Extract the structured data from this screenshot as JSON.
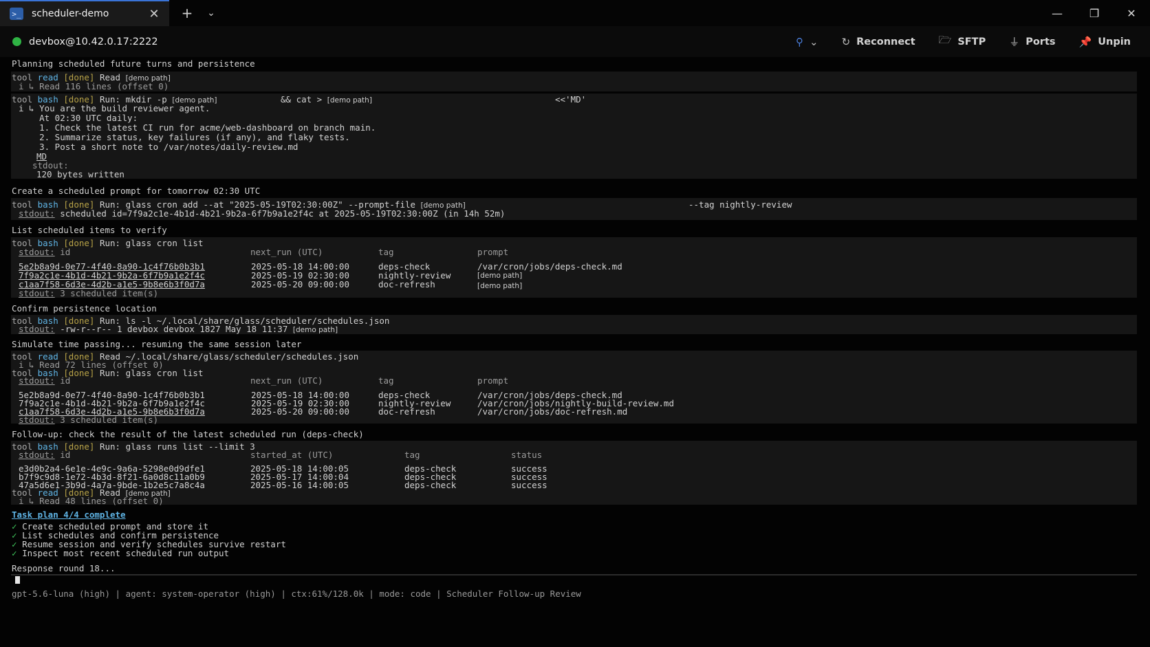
{
  "tab": {
    "title": "scheduler-demo",
    "icon": "terminal-icon"
  },
  "host": {
    "label": "devbox@10.42.0.17:2222",
    "status_color": "#2fb344"
  },
  "actions": {
    "reconnect": "Reconnect",
    "sftp": "SFTP",
    "ports": "Ports",
    "unpin": "Unpin"
  },
  "chip": "[demo path]",
  "s1": {
    "heading": "Planning scheduled future turns and persistence",
    "t1": {
      "tool": "tool",
      "name": "read",
      "status": "[done]",
      "cmd": "Read",
      "sub": "i ↳ Read 116 lines (offset 0)"
    },
    "t2": {
      "tool": "tool",
      "name": "bash",
      "status": "[done]",
      "cmd_a": "Run: mkdir -p",
      "cmd_b": "&& cat >",
      "cmd_c": "<<'MD'",
      "lines": [
        "i ↳ You are the build reviewer agent.",
        "    At 02:30 UTC daily:",
        "    1. Check the latest CI run for acme/web-dashboard on branch main.",
        "    2. Summarize status, key failures (if any), and flaky tests.",
        "    3. Post a short note to /var/notes/daily-review.md"
      ],
      "md": "MD",
      "stdout": "stdout:",
      "written": "120 bytes written"
    }
  },
  "s2": {
    "heading": "Create a scheduled prompt for tomorrow 02:30 UTC",
    "cmd_a": "Run: glass cron add --at \"2025-05-19T02:30:00Z\" --prompt-file",
    "cmd_b": "--tag nightly-review",
    "stdout": "stdout:",
    "out": "scheduled id=7f9a2c1e-4b1d-4b21-9b2a-6f7b9a1e2f4c at 2025-05-19T02:30:00Z (in 14h 52m)"
  },
  "s3": {
    "heading": "List scheduled items to verify",
    "cmd": "Run: glass cron list",
    "headers": [
      "id",
      "next_run (UTC)",
      "tag",
      "prompt"
    ],
    "rows": [
      {
        "id": "5e2b8a9d-0e77-4f40-8a90-1c4f76b0b3b1",
        "next_run": "2025-05-18 14:00:00",
        "tag": "deps-check",
        "prompt": "/var/cron/jobs/deps-check.md"
      },
      {
        "id": "7f9a2c1e-4b1d-4b21-9b2a-6f7b9a1e2f4c",
        "next_run": "2025-05-19 02:30:00",
        "tag": "nightly-review",
        "prompt": "[demo path]"
      },
      {
        "id": "c1aa7f58-6d3e-4d2b-a1e5-9b8e6b3f0d7a",
        "next_run": "2025-05-20 09:00:00",
        "tag": "doc-refresh",
        "prompt": "[demo path]"
      }
    ],
    "count": "3 scheduled item(s)"
  },
  "s4": {
    "heading": "Confirm persistence location",
    "cmd": "Run: ls -l ~/.local/share/glass/scheduler/schedules.json",
    "out": "-rw-r--r-- 1 devbox devbox 1827 May 18 11:37"
  },
  "s5": {
    "heading": "Simulate time passing... resuming the same session later",
    "read": "Read ~/.local/share/glass/scheduler/schedules.json",
    "readsub": "i ↳ Read 72 lines (offset 0)",
    "cmd": "Run: glass cron list",
    "rows": [
      {
        "id": "5e2b8a9d-0e77-4f40-8a90-1c4f76b0b3b1",
        "next_run": "2025-05-18 14:00:00",
        "tag": "deps-check",
        "prompt": "/var/cron/jobs/deps-check.md"
      },
      {
        "id": "7f9a2c1e-4b1d-4b21-9b2a-6f7b9a1e2f4c",
        "next_run": "2025-05-19 02:30:00",
        "tag": "nightly-review",
        "prompt": "/var/cron/jobs/nightly-build-review.md"
      },
      {
        "id": "c1aa7f58-6d3e-4d2b-a1e5-9b8e6b3f0d7a",
        "next_run": "2025-05-20 09:00:00",
        "tag": "doc-refresh",
        "prompt": "/var/cron/jobs/doc-refresh.md"
      }
    ],
    "count": "3 scheduled item(s)"
  },
  "s6": {
    "heading": "Follow-up: check the result of the latest scheduled run (deps-check)",
    "cmd": "Run: glass runs list --limit 3",
    "headers": [
      "id",
      "started_at (UTC)",
      "tag",
      "status"
    ],
    "rows": [
      {
        "id": "e3d0b2a4-6e1e-4e9c-9a6a-5298e0d9dfe1",
        "started": "2025-05-18 14:00:05",
        "tag": "deps-check",
        "status": "success"
      },
      {
        "id": "b7f9c9d8-1e72-4b3d-8f21-6a0d8c11a0b9",
        "started": "2025-05-17 14:00:04",
        "tag": "deps-check",
        "status": "success"
      },
      {
        "id": "47a5d6e1-3b9d-4a7a-9bde-1b2e5c7a8c4a",
        "started": "2025-05-16 14:00:05",
        "tag": "deps-check",
        "status": "success"
      }
    ],
    "readsub": "i ↳ Read 48 lines (offset 0)"
  },
  "plan": {
    "title": "Task plan 4/4 complete",
    "items": [
      "Create scheduled prompt and store it",
      "List schedules and confirm persistence",
      "Resume session and verify schedules survive restart",
      "Inspect most recent scheduled run output"
    ]
  },
  "response": "Response round 18...",
  "status": "gpt-5.6-luna (high) | agent: system-operator (high) | ctx:61%/128.0k | mode: code | Scheduler Follow-up Review"
}
